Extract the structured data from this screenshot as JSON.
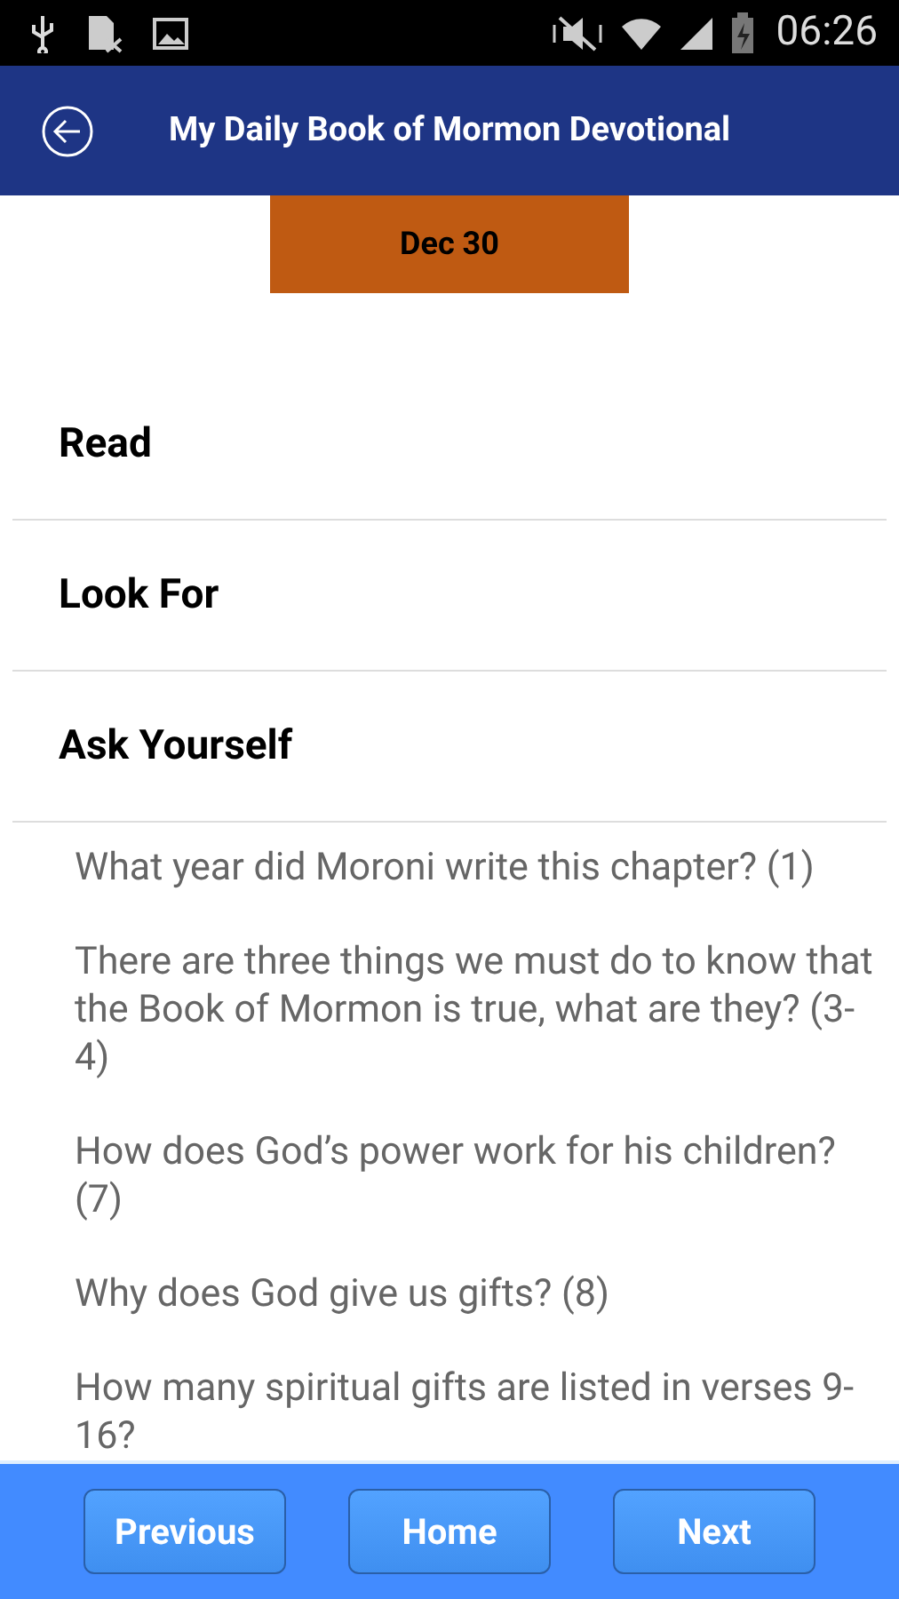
{
  "status_bar": {
    "time": "06:26"
  },
  "header": {
    "title": "My Daily Book of Mormon Devotional"
  },
  "date": "Dec 30",
  "sections": [
    {
      "title": "Read"
    },
    {
      "title": "Look For"
    },
    {
      "title": "Ask Yourself",
      "items": [
        "What year did Moroni write this chapter? (1)",
        "There are three things we must do to know that the Book of Mormon is true, what are they? (3-4)",
        "How does God’s power work for his children? (7)",
        "Why does God give us gifts? (8)",
        "How many spiritual gifts are listed in verses 9-16?"
      ]
    }
  ],
  "buttons": [
    "Previous",
    "Home",
    "Next"
  ]
}
